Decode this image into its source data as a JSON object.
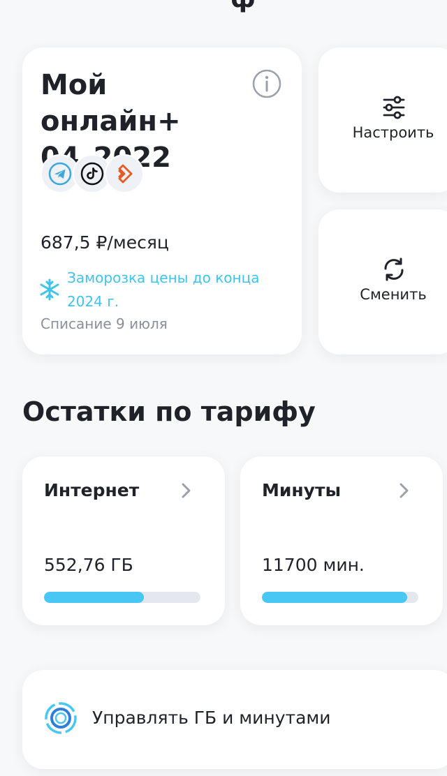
{
  "header": {
    "partial_title": "ф"
  },
  "tariff": {
    "name": "Мой онлайн+ 04_2022",
    "apps": [
      {
        "name": "telegram-icon",
        "color": "#3aa7e0"
      },
      {
        "name": "tiktok-icon",
        "color": "#111111"
      },
      {
        "name": "app-icon",
        "color": "#e85a24"
      }
    ],
    "price": "687,5 ₽/месяц",
    "freeze_note": "Заморозка цены до конца 2024 г.",
    "charge_date": "Списание 9 июля"
  },
  "actions": {
    "configure_label": "Настроить",
    "change_label": "Сменить"
  },
  "balances": {
    "title": "Остатки по тарифу",
    "internet": {
      "name": "Интернет",
      "value": "552,76 ГБ",
      "fill_fraction": 0.64
    },
    "minutes": {
      "name": "Минуты",
      "value": "11700 мин.",
      "fill_fraction": 0.93
    }
  },
  "manage": {
    "label": "Управлять ГБ и минутами"
  },
  "colors": {
    "accent": "#3fc3ef",
    "progress": "#48c6f4",
    "text": "#1f2229",
    "muted": "#8a8f99",
    "background": "#f7f8fa"
  }
}
